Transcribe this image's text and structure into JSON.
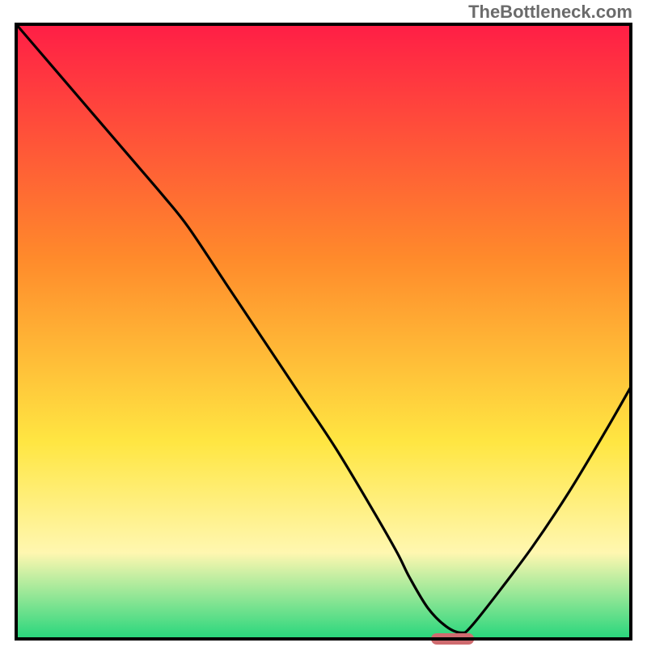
{
  "attribution": "TheBottleneck.com",
  "chart_data": {
    "type": "line",
    "title": "",
    "xlabel": "",
    "ylabel": "",
    "xlim": [
      0,
      100
    ],
    "ylim": [
      0,
      100
    ],
    "series": [
      {
        "name": "curve",
        "x": [
          0,
          6,
          12,
          18,
          24,
          28,
          34,
          40,
          46,
          52,
          58,
          62,
          64,
          67,
          70,
          72.5,
          74,
          78,
          84,
          90,
          96,
          100
        ],
        "y": [
          100,
          93,
          86,
          79,
          72,
          67,
          58,
          49,
          40,
          31,
          21,
          14,
          10,
          5,
          2,
          1,
          2,
          7,
          15,
          24,
          34,
          41
        ]
      }
    ],
    "marker": {
      "name": "optimal-marker",
      "x_center": 71,
      "half_width": 3.5,
      "y": 0,
      "color": "#cf6b6f"
    },
    "background_gradient": {
      "top": "#ff1e46",
      "mid1": "#ff8a2b",
      "mid2": "#ffe642",
      "mid3": "#fff7b0",
      "bottom": "#27d67c"
    },
    "frame_color": "#000000",
    "curve_color": "#000000"
  }
}
